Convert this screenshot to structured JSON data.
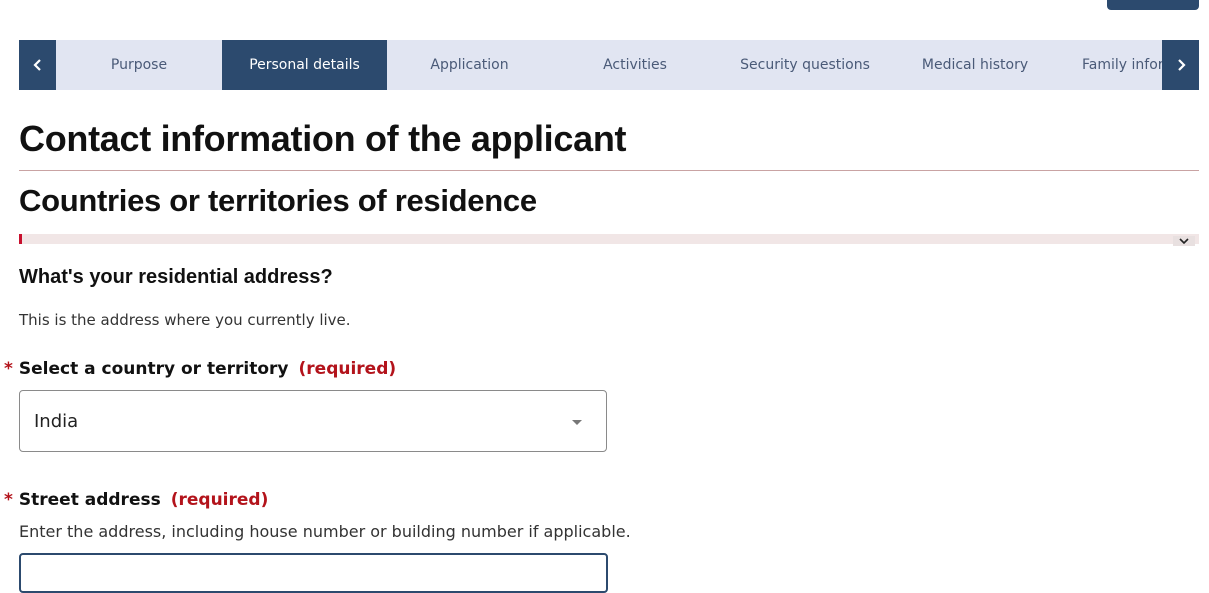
{
  "nav": {
    "prev_label": "Previous",
    "next_label": "Next",
    "tabs": [
      {
        "label": "Purpose",
        "active": false
      },
      {
        "label": "Personal details",
        "active": true
      },
      {
        "label": "Application",
        "active": false
      },
      {
        "label": "Activities",
        "active": false
      },
      {
        "label": "Security questions",
        "active": false
      },
      {
        "label": "Medical history",
        "active": false
      },
      {
        "label": "Family infor",
        "active": false
      }
    ]
  },
  "page": {
    "title": "Contact information of the applicant",
    "section_title": "Countries or territories of residence"
  },
  "question": {
    "title": "What's your residential address?",
    "description": "This is the address where you currently live."
  },
  "fields": {
    "country": {
      "required_marker": "*",
      "label": "Select a country or territory",
      "required_text": "(required)",
      "value": "India"
    },
    "street": {
      "required_marker": "*",
      "label": "Street address",
      "required_text": "(required)",
      "hint": "Enter the address, including house number or building number if applicable.",
      "value": ""
    }
  },
  "colors": {
    "primary": "#2c4a6e",
    "tab_bg": "#e1e5f2",
    "required": "#b3131b",
    "alert_bg": "#f1e6e6"
  }
}
